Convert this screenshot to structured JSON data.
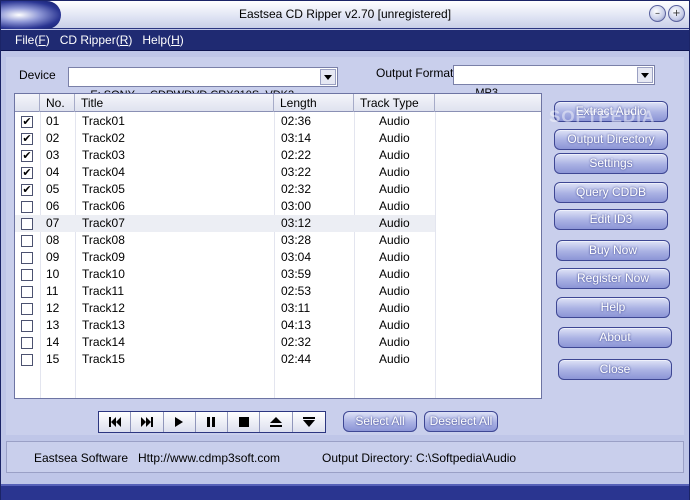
{
  "window": {
    "title": "Eastsea  CD Ripper v2.70 [unregistered]"
  },
  "menu": [
    {
      "label": "File(",
      "key": "F",
      "tail": ")"
    },
    {
      "label": "CD Ripper(",
      "key": "R",
      "tail": ")"
    },
    {
      "label": "Help(",
      "key": "H",
      "tail": ")"
    }
  ],
  "device": {
    "label": "Device",
    "value": "E: SONY     CDRWDVD CRX310S  VDK2"
  },
  "output_format": {
    "label": "Output Format",
    "value": "MP3"
  },
  "table": {
    "headers": [
      "No.",
      "Title",
      "Length",
      "Track Type"
    ],
    "rows": [
      {
        "checked": true,
        "no": "01",
        "title": "Track01",
        "length": "02:36",
        "type": "Audio"
      },
      {
        "checked": true,
        "no": "02",
        "title": "Track02",
        "length": "03:14",
        "type": "Audio"
      },
      {
        "checked": true,
        "no": "03",
        "title": "Track03",
        "length": "02:22",
        "type": "Audio"
      },
      {
        "checked": true,
        "no": "04",
        "title": "Track04",
        "length": "03:22",
        "type": "Audio"
      },
      {
        "checked": true,
        "no": "05",
        "title": "Track05",
        "length": "02:32",
        "type": "Audio"
      },
      {
        "checked": false,
        "no": "06",
        "title": "Track06",
        "length": "03:00",
        "type": "Audio"
      },
      {
        "checked": false,
        "no": "07",
        "title": "Track07",
        "length": "03:12",
        "type": "Audio"
      },
      {
        "checked": false,
        "no": "08",
        "title": "Track08",
        "length": "03:28",
        "type": "Audio"
      },
      {
        "checked": false,
        "no": "09",
        "title": "Track09",
        "length": "03:04",
        "type": "Audio"
      },
      {
        "checked": false,
        "no": "10",
        "title": "Track10",
        "length": "03:59",
        "type": "Audio"
      },
      {
        "checked": false,
        "no": "11",
        "title": "Track11",
        "length": "02:53",
        "type": "Audio"
      },
      {
        "checked": false,
        "no": "12",
        "title": "Track12",
        "length": "03:11",
        "type": "Audio"
      },
      {
        "checked": false,
        "no": "13",
        "title": "Track13",
        "length": "04:13",
        "type": "Audio"
      },
      {
        "checked": false,
        "no": "14",
        "title": "Track14",
        "length": "02:32",
        "type": "Audio"
      },
      {
        "checked": false,
        "no": "15",
        "title": "Track15",
        "length": "02:44",
        "type": "Audio"
      }
    ]
  },
  "buttons": {
    "extract_audio": "Extract Audio",
    "output_directory": "Output Directory",
    "settings": "Settings",
    "query_cddb": "Query CDDB",
    "edit_id3": "Edit ID3",
    "buy_now": "Buy Now",
    "register_now": "Register Now",
    "help": "Help",
    "about": "About",
    "close": "Close",
    "select_all": "Select All",
    "deselect_all": "Deselect All"
  },
  "transport": [
    "previous-track-icon",
    "next-track-icon",
    "play-icon",
    "pause-icon",
    "stop-icon",
    "eject-icon",
    "close-tray-icon"
  ],
  "status": {
    "company": "Eastsea Software",
    "website": "Http://www.cdmp3soft.com",
    "output_dir": "Output Directory: C:\\Softpedia\\Audio"
  },
  "watermark": "SOFTPEDIA",
  "colors": {
    "menubar": "#1f2a72",
    "panel": "#c9cfec",
    "button": "#a9b1e3",
    "frame": "#2a3590"
  }
}
